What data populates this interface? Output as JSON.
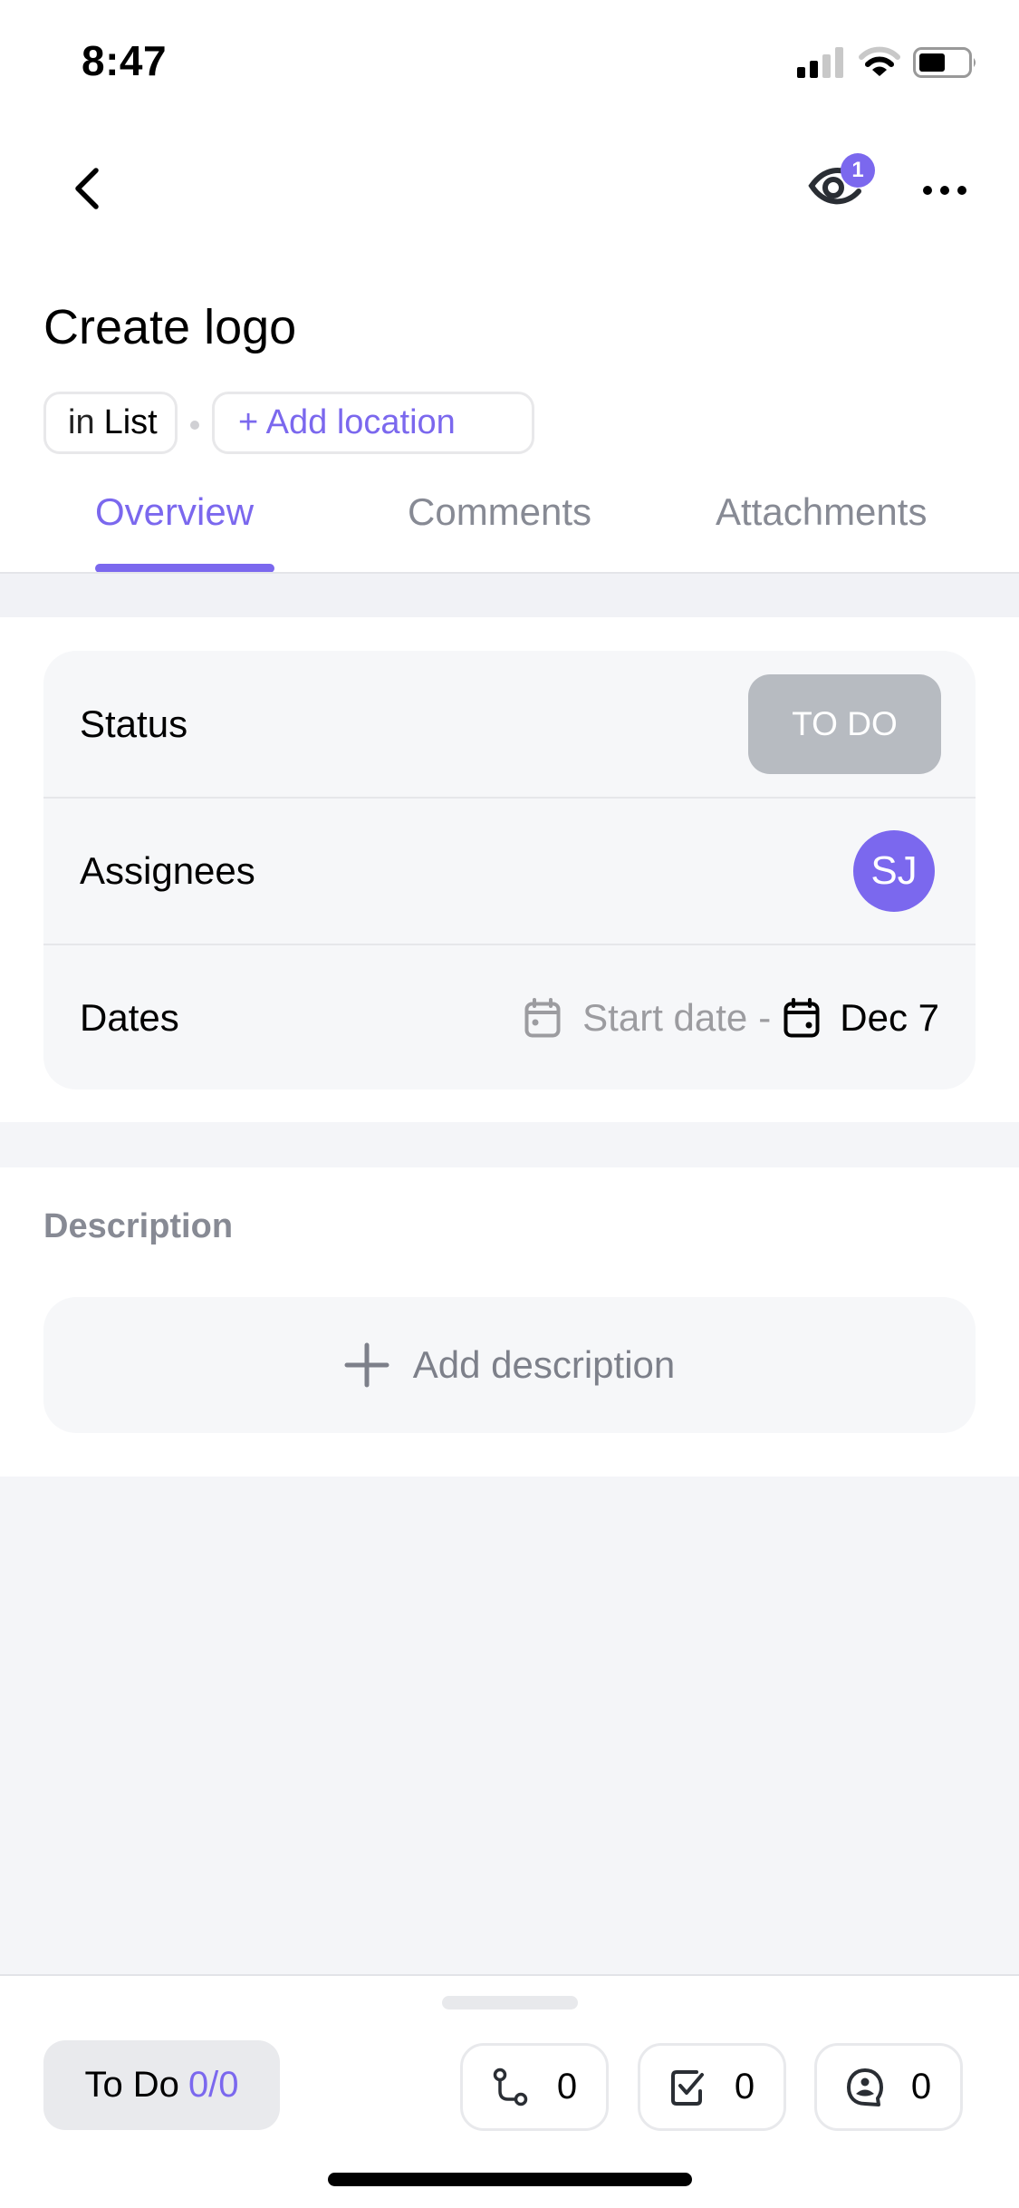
{
  "status_bar": {
    "time": "8:47",
    "signal_bars": 2,
    "signal_bars_total": 4,
    "wifi_arcs": 2,
    "wifi_arcs_total": 3,
    "battery_level": 0.5
  },
  "nav": {
    "back_icon": "chevron-left-icon",
    "watchers_icon": "eye-icon",
    "watchers_count": "1",
    "more_icon": "ellipsis-icon"
  },
  "task": {
    "title": "Create logo",
    "location_prefix": "in",
    "location_name": "List",
    "add_location_label": "+ Add location"
  },
  "tabs": [
    {
      "label": "Overview",
      "active": true
    },
    {
      "label": "Comments",
      "active": false
    },
    {
      "label": "Attachments",
      "active": false
    }
  ],
  "fields": {
    "status": {
      "label": "Status",
      "value": "TO DO",
      "color": "#b7bbc1"
    },
    "assignees": {
      "label": "Assignees",
      "initials": "SJ",
      "avatar_color": "#7b68ee"
    },
    "dates": {
      "label": "Dates",
      "start_placeholder": "Start date",
      "separator": "-",
      "due": "Dec 7"
    }
  },
  "description": {
    "label": "Description",
    "add_label": "Add description"
  },
  "bottom_bar": {
    "status_label": "To Do",
    "status_count": "0/0",
    "counters": [
      {
        "icon": "subtask-icon",
        "value": "0"
      },
      {
        "icon": "checklist-icon",
        "value": "0"
      },
      {
        "icon": "assigned-comment-icon",
        "value": "0"
      }
    ]
  },
  "colors": {
    "accent": "#7b68ee",
    "muted_text": "#878a94",
    "card_bg": "#f6f7f9"
  }
}
